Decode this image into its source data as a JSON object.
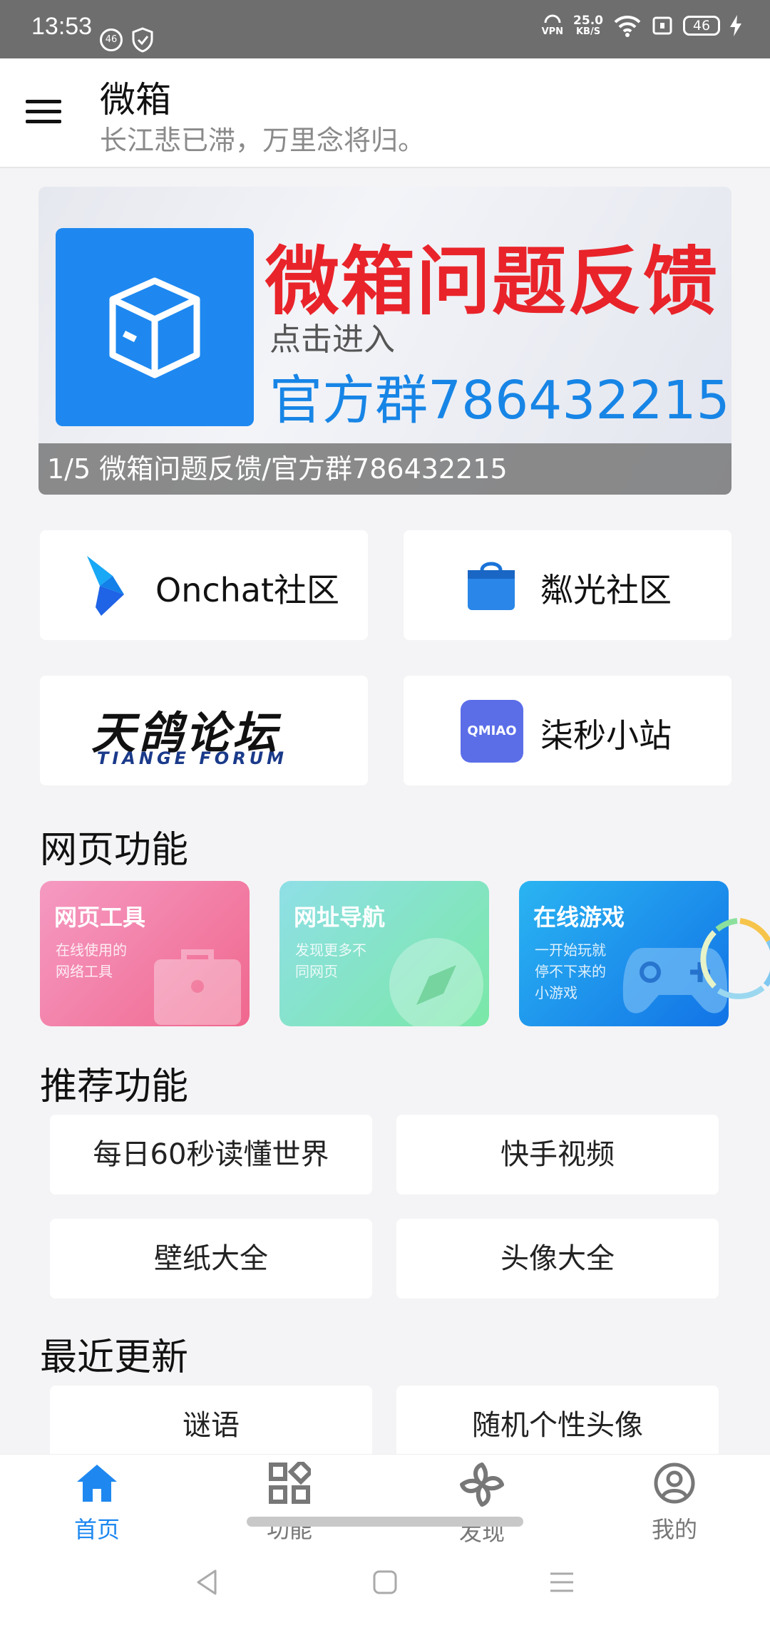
{
  "status_bar": {
    "time": "13:53",
    "badge_left": "46",
    "vpn": "VPN",
    "speed_value": "25.0",
    "speed_unit": "KB/S",
    "battery": "46"
  },
  "app_bar": {
    "title": "微箱",
    "subtitle": "长江悲已滞，万里念将归。"
  },
  "banner": {
    "title": "微箱问题反馈",
    "subtitle": "点击进入",
    "group": "官方群786432215",
    "caption": "1/5 微箱问题反馈/官方群786432215"
  },
  "communities": [
    {
      "label": "Onchat社区"
    },
    {
      "label": "粼光社区"
    },
    {
      "label": "天鸽论坛",
      "sub": "TIANGE FORUM"
    },
    {
      "label": "柒秒小站",
      "logo_text": "QMIAO"
    }
  ],
  "sections": {
    "web": "网页功能",
    "recommended": "推荐功能",
    "recent": "最近更新"
  },
  "web_tiles": [
    {
      "title": "网页工具",
      "desc_line1": "在线使用的",
      "desc_line2": "网络工具",
      "desc_line3": ""
    },
    {
      "title": "网址导航",
      "desc_line1": "发现更多不",
      "desc_line2": "同网页",
      "desc_line3": ""
    },
    {
      "title": "在线游戏",
      "desc_line1": "一开始玩就",
      "desc_line2": "停不下来的",
      "desc_line3": "小游戏"
    }
  ],
  "recommended": [
    "每日60秒读懂世界",
    "快手视频",
    "壁纸大全",
    "头像大全"
  ],
  "recent": [
    "谜语",
    "随机个性头像"
  ],
  "bottom_nav": [
    {
      "label": "首页",
      "icon": "home-icon",
      "active": true
    },
    {
      "label": "功能",
      "icon": "grid-icon",
      "active": false
    },
    {
      "label": "发现",
      "icon": "pinwheel-icon",
      "active": false
    },
    {
      "label": "我的",
      "icon": "user-icon",
      "active": false
    }
  ],
  "colors": {
    "accent": "#1e88f0",
    "banner_red": "#e8242a",
    "background": "#f4f4f6"
  }
}
